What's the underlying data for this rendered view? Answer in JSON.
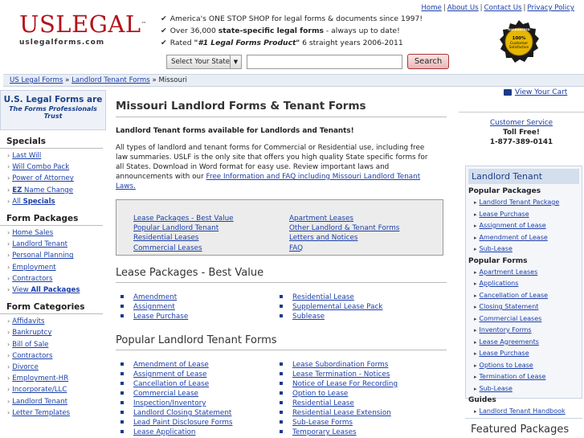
{
  "header": {
    "logo_brand": "USLEGAL",
    "logo_tm": "™",
    "logo_url": "uslegalforms.com",
    "taglines": [
      {
        "pre": "America's ONE STOP SHOP for legal forms & documents since 1997!",
        "bold": "",
        "post": ""
      },
      {
        "pre": "Over 36,000 ",
        "bold": "state-specific legal forms",
        "post": " - always up to date!"
      },
      {
        "pre": "Rated ",
        "bold": "\"#1 Legal Forms Product\"",
        "post": " 6 straight years 2006-2011"
      }
    ],
    "top_nav": [
      "Home",
      "About Us",
      "Contact Us",
      "Privacy Policy"
    ],
    "seal": {
      "line1": "GUARANTEED",
      "line2": "100%",
      "line3": "Customer",
      "line4": "Satisfaction"
    },
    "state_select": "Select Your State",
    "search_placeholder": "",
    "search_button": "Search"
  },
  "breadcrumb": {
    "items": [
      "US Legal Forms",
      "Landlord Tenant Forms"
    ],
    "current": "Missouri",
    "sep": "»"
  },
  "left": {
    "trust_line1": "U.S. Legal Forms are",
    "trust_line2": "The Forms Professionals Trust",
    "sections": [
      {
        "title": "Specials",
        "items": [
          "Last Will",
          "Will Combo Pack",
          "Power of Attorney",
          "EZ Name Change",
          "All Specials"
        ]
      },
      {
        "title": "Form Packages",
        "items": [
          "Home Sales",
          "Landlord Tenant",
          "Personal Planning",
          "Employment",
          "Contractors",
          "View All Packages"
        ]
      },
      {
        "title": "Form Categories",
        "items": [
          "Affidavits",
          "Bankruptcy",
          "Bill of Sale",
          "Contractors",
          "Divorce",
          "Employment-HR",
          "Incorporate/LLC",
          "Landlord Tenant",
          "Letter Templates"
        ]
      }
    ]
  },
  "main": {
    "title": "Missouri Landlord Forms & Tenant Forms",
    "intro_bold": "Landlord Tenant forms available for Landlords and Tenants!",
    "intro_text": "All types of landlord and tenant forms for Commercial or Residential use, including free law summaries.  USLF is the only site that offers you high quality State specific forms for all States. Download in Word format for easy use.  Review important laws and announcements with our ",
    "intro_link": "Free Information and FAQ including Missouri Landlord Tenant Laws.",
    "jump_left": [
      "Lease Packages - Best Value",
      "Popular Landlord Tenant",
      "Residential Leases",
      "Commercial Leases"
    ],
    "jump_right": [
      "Apartment Leases",
      "Other Landlord & Tenant Forms",
      "Letters and Notices",
      "FAQ"
    ],
    "section1_title": "Lease Packages - Best Value",
    "section1_left": [
      "Amendment",
      "Assignment",
      "Lease Purchase"
    ],
    "section1_right": [
      "Residential Lease",
      "Supplemental Lease Pack",
      "Sublease"
    ],
    "section2_title": "Popular Landlord Tenant Forms",
    "section2_left": [
      "Amendment of Lease",
      "Assignment of Lease",
      "Cancellation of Lease",
      "Commercial Lease",
      "Inspection/Inventory",
      "Landlord Closing Statement",
      "Lead Paint Disclosure Forms",
      "Lease Application"
    ],
    "section2_right": [
      "Lease Subordination Forms",
      "Lease Termination - Notices",
      "Notice of Lease For Recording",
      "Option to Lease",
      "Residential Lease",
      "Residential Lease Extension",
      "Sub-Lease Forms",
      "Temporary Leases"
    ]
  },
  "right": {
    "cart": "View Your Cart",
    "cs_link": "Customer Service",
    "cs_tollfree": "Toll Free!",
    "cs_phone": "1-877-389-0141",
    "panel_title": "Landlord Tenant",
    "groups": [
      {
        "title": "Popular Packages",
        "items": [
          "Landlord Tenant Package",
          "Lease Purchase",
          "Assignment of Lease",
          "Amendment of Lease",
          "Sub-Lease"
        ]
      },
      {
        "title": "Popular Forms",
        "items": [
          "Apartment Leases",
          "Applications",
          "Cancellation of Lease",
          "Closing Statement",
          "Commercial Leases",
          "Inventory Forms",
          "Lease Agreements",
          "Lease Purchase",
          "Options to Lease",
          "Termination of Lease",
          "Sub-Lease"
        ]
      },
      {
        "title": "Guides",
        "items": [
          "Landlord Tenant Handbook"
        ]
      }
    ],
    "featured": "Featured Packages"
  }
}
